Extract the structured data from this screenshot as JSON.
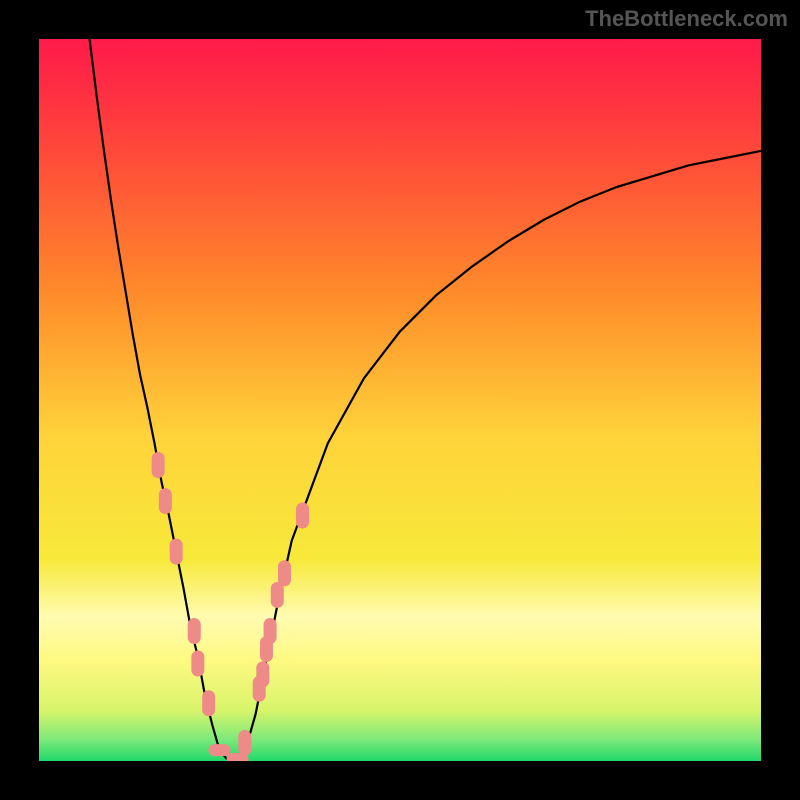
{
  "watermark": "TheBottleneck.com",
  "chart_data": {
    "type": "line",
    "title": "",
    "xlabel": "",
    "ylabel": "",
    "xlim": [
      0,
      100
    ],
    "ylim": [
      0,
      100
    ],
    "background_gradient": {
      "stops": [
        {
          "pct": 0,
          "color": "#ff1a4a"
        },
        {
          "pct": 12,
          "color": "#ff3d3d"
        },
        {
          "pct": 35,
          "color": "#ff8a2a"
        },
        {
          "pct": 55,
          "color": "#ffd33a"
        },
        {
          "pct": 72,
          "color": "#f7e93a"
        },
        {
          "pct": 80,
          "color": "#fffbb0"
        },
        {
          "pct": 86,
          "color": "#fff982"
        },
        {
          "pct": 93,
          "color": "#d7f46a"
        },
        {
          "pct": 97,
          "color": "#7de97a"
        },
        {
          "pct": 100,
          "color": "#1fd96a"
        }
      ]
    },
    "series": [
      {
        "name": "bottleneck-curve",
        "x": [
          7.0,
          8.0,
          9.0,
          10.0,
          11.0,
          12.0,
          13.0,
          14.0,
          15.0,
          16.0,
          17.0,
          18.0,
          19.0,
          20.0,
          21.0,
          22.0,
          23.0,
          24.0,
          25.0,
          26.0,
          27.0,
          28.0,
          29.0,
          30.0,
          31.0,
          32.0,
          33.0,
          34.0,
          35.0,
          40.0,
          45.0,
          50.0,
          55.0,
          60.0,
          65.0,
          70.0,
          75.0,
          80.0,
          85.0,
          90.0,
          95.0,
          100.0
        ],
        "y": [
          100.0,
          92.0,
          84.5,
          77.5,
          71.0,
          65.0,
          59.0,
          53.5,
          49.0,
          44.0,
          38.5,
          34.0,
          29.0,
          24.0,
          18.5,
          14.5,
          9.0,
          5.0,
          1.5,
          0.3,
          0.2,
          0.5,
          3.0,
          6.5,
          11.5,
          16.5,
          21.5,
          26.0,
          30.5,
          44.0,
          53.0,
          59.5,
          64.5,
          68.5,
          72.0,
          75.0,
          77.5,
          79.5,
          81.0,
          82.5,
          83.5,
          84.5
        ]
      },
      {
        "name": "data-points",
        "x": [
          16.5,
          17.5,
          19.0,
          21.5,
          22.0,
          23.5,
          25.0,
          27.5,
          28.5,
          30.5,
          31.0,
          31.5,
          32.0,
          33.0,
          34.0,
          36.5
        ],
        "y": [
          41.0,
          36.0,
          29.0,
          18.0,
          13.5,
          8.0,
          1.5,
          0.3,
          2.5,
          10.0,
          12.0,
          15.5,
          18.0,
          23.0,
          26.0,
          34.0
        ]
      }
    ],
    "vertex": {
      "x": 26.5,
      "y": 0
    }
  }
}
